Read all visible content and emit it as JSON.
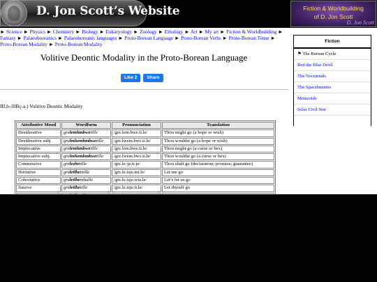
{
  "header": {
    "site_title": "D. Jon Scott’s Website",
    "banner_line1": "Fiction & Worldbuilding",
    "banner_line2": "of D. Jon Scott",
    "banner_signature": "D. Jon Scott"
  },
  "breadcrumbs": [
    "Science",
    "Physics",
    "Chemistry",
    "Biology",
    "Eukaryology",
    "Zoology",
    "Ethology",
    "Art",
    "My art",
    "Fiction & Worldbuilding",
    "Fantasy",
    "Palaeoboreanics",
    "Palaeoboreanic languages",
    "Proto-Borean Language",
    "Proto-Borean Verbs",
    "Proto-Borean Tense",
    "Proto-Borean Modality",
    "Proto-Borean Modality"
  ],
  "breadcrumb_separator": "►",
  "page_title": "Volitive Deontic Modality in the Proto-Borean Language",
  "facebook": {
    "like_label": "Like 2",
    "share_label": "Share"
  },
  "section_heading": "III.b-10Bç-a.) Volitive Deontic Modality",
  "table": {
    "headers": [
      "Attributive Mood",
      "Wordform",
      "Pronunciation",
      "Translation"
    ],
    "rows": [
      {
        "mood": "Desiderative",
        "stem": "gre",
        "mid": "lemhmbwe",
        "suf": "tille",
        "pron": "/grɛ.lem.bwɛ.ti.le/",
        "trans": "Thou might go (a hope or wish)"
      },
      {
        "mood": "Desiderative subj.",
        "stem": "gre",
        "mid": "lmhembmbwe",
        "suf": "tille",
        "pron": "/grɛ.lwem.bwɛ.ti.le/",
        "trans": "Thou wouldst go (a hope or wish)"
      },
      {
        "mood": "Imprecative",
        "stem": "gre",
        "mid": "lemhmbwe",
        "suf": "tille",
        "pron": "/grɛ.lem.bwɛ.ti.le/",
        "trans": "Thou might go (a curse or hex)"
      },
      {
        "mood": "Imprecative subj.",
        "stem": "gre",
        "mid": "lmhembmbwe",
        "suf": "tille",
        "pron": "/grɛ.lwem.bwɛ.ti.le/",
        "trans": "Thou wouldst go (a curse or hex)"
      },
      {
        "mood": "Commissive",
        "stem": "gre",
        "mid": "lezhe",
        "suf": "tille",
        "pron": "/grɛ.le.ʒe.ti.je/",
        "trans": "Thou shalt go (declaration; promise; guarantee)"
      },
      {
        "mood": "Hortative",
        "stem": "gre",
        "mid": "letlhe",
        "suf": "mille",
        "pron": "/grɛ.le.tsje.mi.le/",
        "trans": "Let me go"
      },
      {
        "mood": "Cohortative",
        "stem": "gre",
        "mid": "letlhe",
        "suf": "mhalle",
        "pron": "/grɛ.le.tsje.wia.le/",
        "trans": "Let’s let us go"
      },
      {
        "mood": "Jussive",
        "stem": "gre",
        "mid": "letlhe",
        "suf": "tille",
        "pron": "/grɛ.le.tsje.ti.le/",
        "trans": "Let thyself go"
      },
      {
        "mood": "Optative",
        "stem": "gre",
        "mid": "letlhe",
        "suf": "tille",
        "pron": "/grɛ.le.tsje.ti.le/",
        "trans": "Let it go"
      }
    ]
  },
  "sidebar": {
    "heading": "Fiction",
    "current_marker": "⚑",
    "items": [
      {
        "label": "The Borean Cycle",
        "current": true
      },
      {
        "label": "Red the Blue Devil",
        "current": false
      },
      {
        "label": "The Nocturnals",
        "current": false
      },
      {
        "label": "The Spacebunnies",
        "current": false
      },
      {
        "label": "Metazoids",
        "current": false
      },
      {
        "label": "Solar Civil War",
        "current": false
      }
    ],
    "footer": "⚑ = You Are Here."
  }
}
